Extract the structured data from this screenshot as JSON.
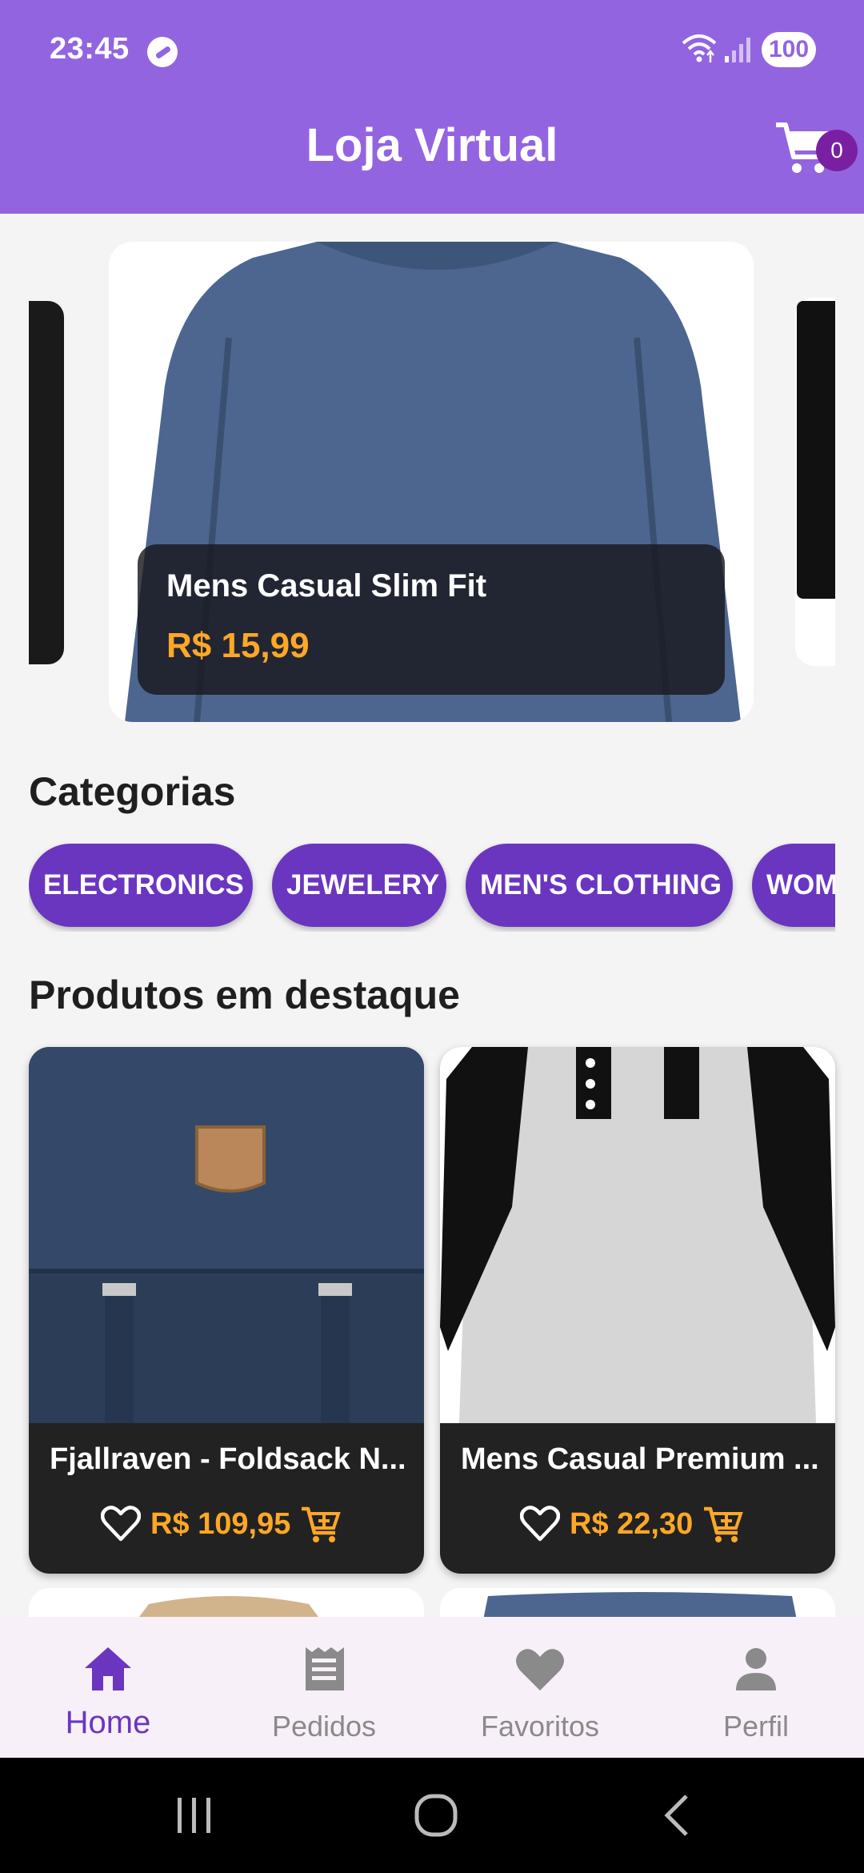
{
  "status_bar": {
    "time": "23:45",
    "battery": "100"
  },
  "app_bar": {
    "title": "Loja Virtual",
    "cart_count": "0",
    "cart_icon": "cart-icon"
  },
  "carousel": {
    "current": {
      "title": "Mens Casual Slim Fit",
      "price": "R$ 15,99"
    }
  },
  "categories": {
    "title": "Categorias",
    "items": [
      "ELECTRONICS",
      "JEWELERY",
      "MEN'S CLOTHING",
      "WOM"
    ]
  },
  "featured": {
    "title": "Produtos em destaque",
    "products": [
      {
        "title": "Fjallraven - Foldsack N...",
        "price": "R$ 109,95"
      },
      {
        "title": "Mens Casual Premium ...",
        "price": "R$ 22,30"
      }
    ]
  },
  "bottom_nav": {
    "items": [
      {
        "label": "Home",
        "icon": "home-icon",
        "active": true
      },
      {
        "label": "Pedidos",
        "icon": "receipt-icon",
        "active": false
      },
      {
        "label": "Favoritos",
        "icon": "heart-icon",
        "active": false
      },
      {
        "label": "Perfil",
        "icon": "person-icon",
        "active": false
      }
    ]
  },
  "colors": {
    "primary": "#9364e0",
    "chip": "#6a36c0",
    "price": "#ffa726",
    "card_dark": "#222222",
    "badge": "#7a1fa2"
  }
}
